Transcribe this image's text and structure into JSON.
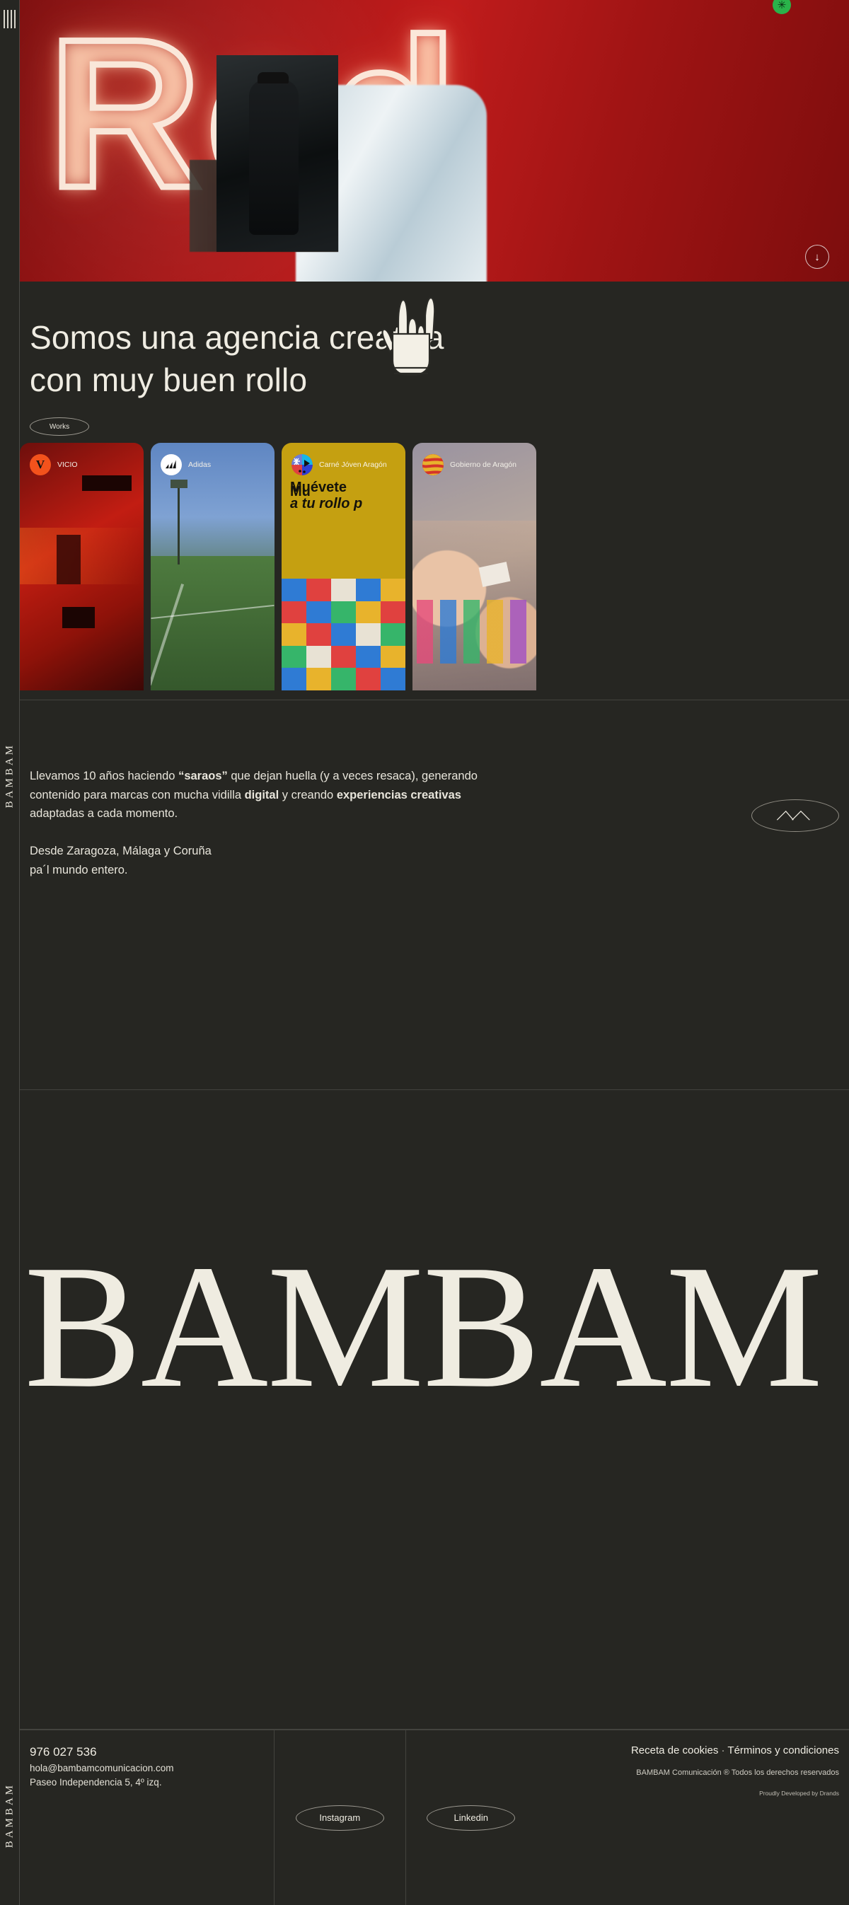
{
  "brand": {
    "name": "BAMBAM",
    "rail_word": "BAMBAM"
  },
  "rail": {
    "menu_icon": "hamburger-vertical-icon"
  },
  "hero": {
    "neon_text": "Red",
    "badge_icon": "spiral-icon",
    "scroll_icon": "arrow-down-icon"
  },
  "statement": {
    "headline_line1": "Somos una agencia creativa",
    "headline_line2": "con muy buen rollo",
    "hand_icon": "rock-hand-icon",
    "works_label": "Works"
  },
  "works": {
    "cards": [
      {
        "label": "VICIO",
        "logo": "vicio-logo",
        "accent": "#f3521c"
      },
      {
        "label": "Adidas",
        "logo": "adidas-logo",
        "accent": "#ffffff"
      },
      {
        "label": "Carné Jóven Aragón",
        "logo": "carne-joven-logo",
        "accent": "#c5a011",
        "overlay_line1": "Muévete",
        "overlay_line1_ghost": "Mu",
        "overlay_line2": "a tu rollo p"
      },
      {
        "label": "Gobierno de Aragón",
        "logo": "gobierno-aragon-logo",
        "accent": "#d11111"
      }
    ]
  },
  "about": {
    "paragraph1_a": "Llevamos 10 años haciendo ",
    "paragraph1_b": "“saraos”",
    "paragraph1_c": " que dejan huella (y a veces resaca), generando contenido para marcas con mucha vidilla ",
    "paragraph1_d": "digital",
    "paragraph1_e": " y creando ",
    "paragraph1_f": "experiencias creativas",
    "paragraph1_g": " adaptadas a cada momento.",
    "paragraph2_line1": "Desde Zaragoza, Málaga y Coruña",
    "paragraph2_line2": "pa´l mundo entero.",
    "badge_icon": "mountains-icon"
  },
  "wordmark": {
    "text": "BAMBAM"
  },
  "footer": {
    "phone": "976 027 536",
    "email": "hola@bambamcomunicacion.com",
    "address": "Paseo Independencia 5, 4º izq.",
    "social": [
      {
        "label": "Instagram"
      },
      {
        "label": "Linkedin"
      }
    ],
    "legal_cookies": "Receta de cookies",
    "legal_separator": "·",
    "legal_terms": "Términos y condiciones",
    "rights": "BAMBAM Comunicación ® Todos los derechos reservados",
    "developed_by": "Proudly Developed by Drands"
  }
}
